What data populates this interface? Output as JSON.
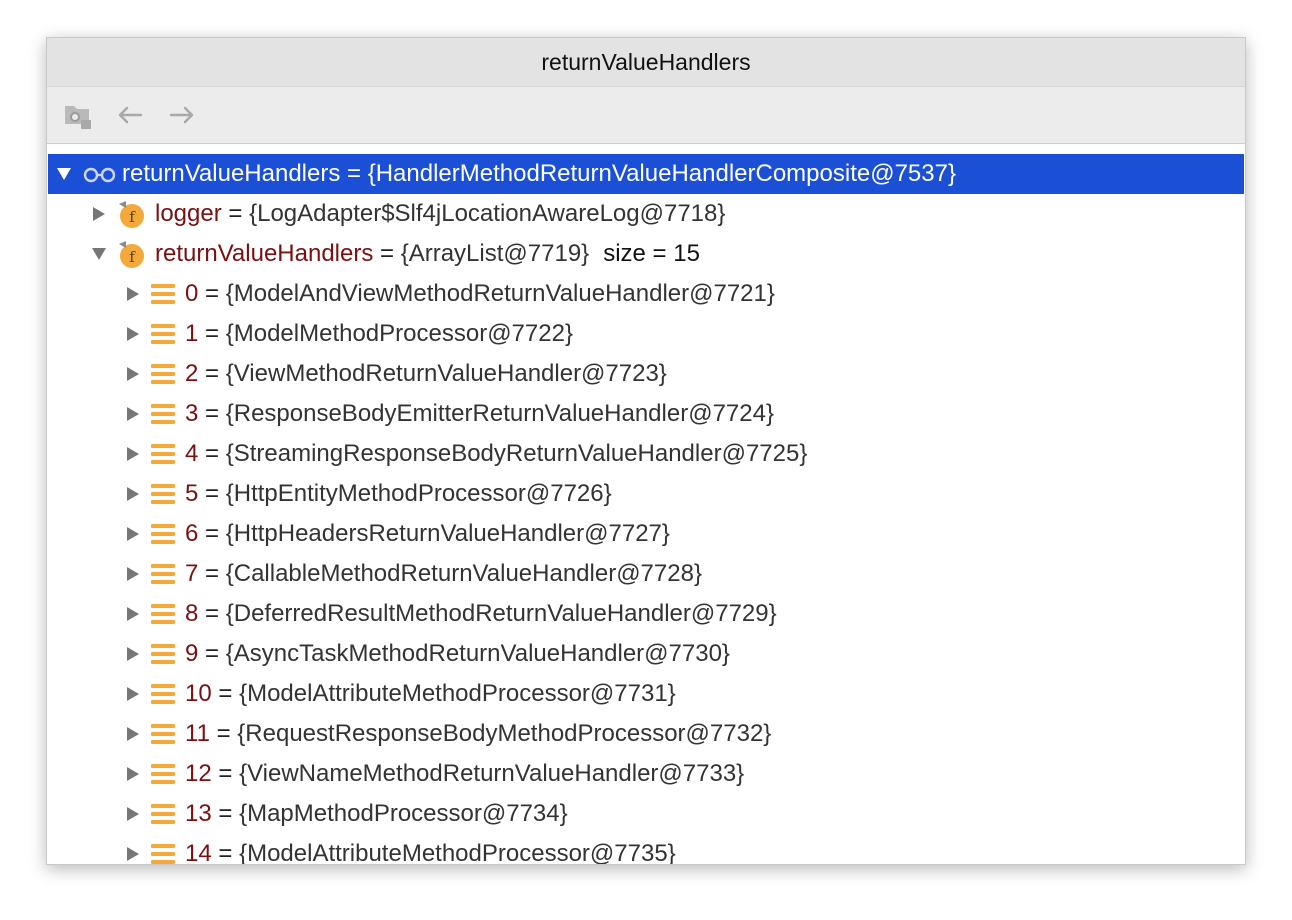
{
  "window": {
    "title": "returnValueHandlers"
  },
  "toolbar": {
    "icons": [
      "folder-settings-icon",
      "back-arrow-icon",
      "forward-arrow-icon"
    ]
  },
  "colors": {
    "selection": "#1a4fd6",
    "field_name": "#7a1010",
    "list_icon": "#f3a93c",
    "field_icon": "#f3a93c"
  },
  "tree": {
    "root": {
      "name": "returnValueHandlers",
      "eq": " = ",
      "value": "{HandlerMethodReturnValueHandlerComposite@7537}"
    },
    "logger": {
      "name": "logger",
      "eq": " = ",
      "value": "{LogAdapter$Slf4jLocationAwareLog@7718}"
    },
    "handlers": {
      "name": "returnValueHandlers",
      "eq": " = ",
      "value": "{ArrayList@7719}",
      "extra": "size = 15"
    },
    "items": [
      {
        "index": "0",
        "eq": " = ",
        "value": "{ModelAndViewMethodReturnValueHandler@7721}"
      },
      {
        "index": "1",
        "eq": " = ",
        "value": "{ModelMethodProcessor@7722}"
      },
      {
        "index": "2",
        "eq": " = ",
        "value": "{ViewMethodReturnValueHandler@7723}"
      },
      {
        "index": "3",
        "eq": " = ",
        "value": "{ResponseBodyEmitterReturnValueHandler@7724}"
      },
      {
        "index": "4",
        "eq": " = ",
        "value": "{StreamingResponseBodyReturnValueHandler@7725}"
      },
      {
        "index": "5",
        "eq": " = ",
        "value": "{HttpEntityMethodProcessor@7726}"
      },
      {
        "index": "6",
        "eq": " = ",
        "value": "{HttpHeadersReturnValueHandler@7727}"
      },
      {
        "index": "7",
        "eq": " = ",
        "value": "{CallableMethodReturnValueHandler@7728}"
      },
      {
        "index": "8",
        "eq": " = ",
        "value": "{DeferredResultMethodReturnValueHandler@7729}"
      },
      {
        "index": "9",
        "eq": " = ",
        "value": "{AsyncTaskMethodReturnValueHandler@7730}"
      },
      {
        "index": "10",
        "eq": " = ",
        "value": "{ModelAttributeMethodProcessor@7731}"
      },
      {
        "index": "11",
        "eq": " = ",
        "value": "{RequestResponseBodyMethodProcessor@7732}"
      },
      {
        "index": "12",
        "eq": " = ",
        "value": "{ViewNameMethodReturnValueHandler@7733}"
      },
      {
        "index": "13",
        "eq": " = ",
        "value": "{MapMethodProcessor@7734}"
      },
      {
        "index": "14",
        "eq": " = ",
        "value": "{ModelAttributeMethodProcessor@7735}"
      }
    ]
  }
}
